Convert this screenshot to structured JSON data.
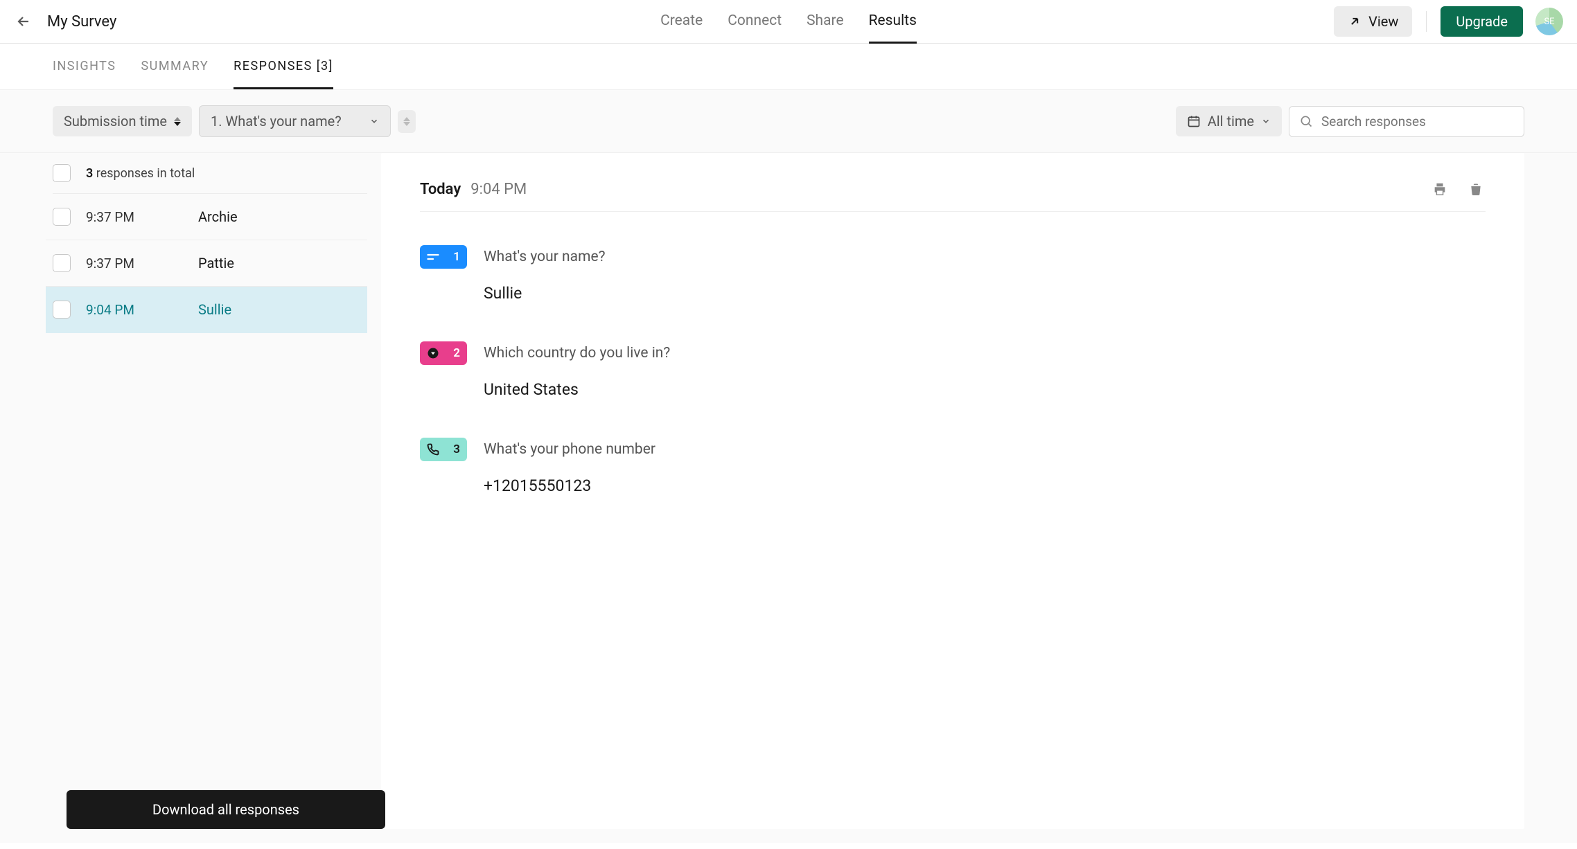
{
  "header": {
    "title": "My Survey",
    "nav": [
      "Create",
      "Connect",
      "Share",
      "Results"
    ],
    "active_nav": 3,
    "view_label": "View",
    "upgrade_label": "Upgrade",
    "avatar_initials": "SE"
  },
  "subnav": {
    "items": [
      "INSIGHTS",
      "SUMMARY",
      "RESPONSES [3]"
    ],
    "active": 2
  },
  "toolbar": {
    "sort_label": "Submission time",
    "question_filter": "1. What's your name?",
    "date_filter": "All time",
    "search_placeholder": "Search responses"
  },
  "list": {
    "total_count": "3",
    "total_suffix": " responses in total",
    "rows": [
      {
        "time": "9:37 PM",
        "name": "Archie",
        "selected": false
      },
      {
        "time": "9:37 PM",
        "name": "Pattie",
        "selected": false
      },
      {
        "time": "9:04 PM",
        "name": "Sullie",
        "selected": true
      }
    ],
    "download_label": "Download all responses"
  },
  "detail": {
    "day": "Today",
    "time": "9:04 PM",
    "qa": [
      {
        "num": "1",
        "badge": "blue",
        "question": "What's your name?",
        "answer": "Sullie"
      },
      {
        "num": "2",
        "badge": "pink",
        "question": "Which country do you live in?",
        "answer": "United States"
      },
      {
        "num": "3",
        "badge": "teal",
        "question": "What's your phone number",
        "answer": "+12015550123"
      }
    ]
  }
}
